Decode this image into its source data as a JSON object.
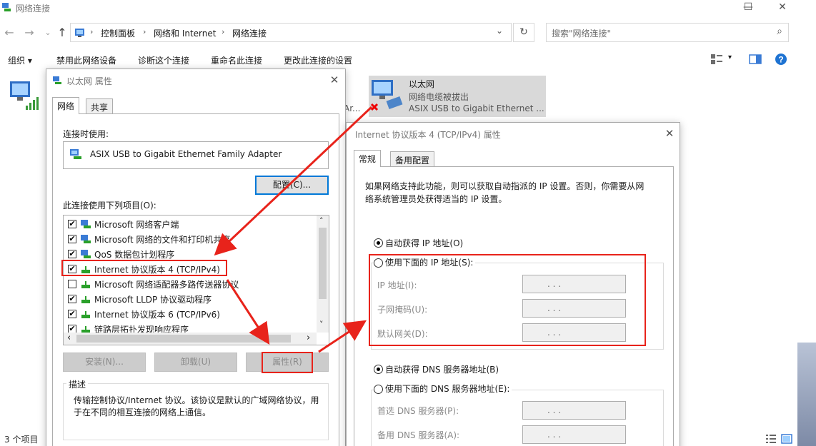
{
  "window": {
    "title": "网络连接",
    "controls": {
      "minimize": "—",
      "maximize": "☐",
      "close": "✕"
    }
  },
  "nav": {
    "back": "←",
    "forward": "→",
    "dropdown": "⌄",
    "up": "↑",
    "address_dropdown": "⌄",
    "refresh": "↻"
  },
  "address": {
    "crumbs": [
      "控制面板",
      "网络和 Internet",
      "网络连接"
    ],
    "sep": "›"
  },
  "search": {
    "placeholder": "搜索\"网络连接\"",
    "icon": "⌕"
  },
  "toolbar": {
    "items": [
      "组织 ▾",
      "禁用此网络设备",
      "诊断这个连接",
      "重命名此连接",
      "更改此连接的设置"
    ],
    "view_arrow": "▾"
  },
  "connection": {
    "name": "以太网",
    "status": "网络电缆被拔出",
    "adapter": "ASIX USB to Gigabit Ethernet ...",
    "partial_label": "Ar..."
  },
  "status_bar": {
    "count": "3 个项目"
  },
  "props_dialog": {
    "title": "以太网 属性",
    "close": "✕",
    "tabs": [
      "网络",
      "共享"
    ],
    "connect_using_label": "连接时使用:",
    "adapter_name": "ASIX USB to Gigabit Ethernet Family Adapter",
    "configure_button": "配置(C)...",
    "items_label": "此连接使用下列项目(O):",
    "items": [
      {
        "checked": true,
        "text": "Microsoft 网络客户端"
      },
      {
        "checked": true,
        "text": "Microsoft 网络的文件和打印机共享"
      },
      {
        "checked": true,
        "text": "QoS 数据包计划程序"
      },
      {
        "checked": true,
        "text": "Internet 协议版本 4 (TCP/IPv4)"
      },
      {
        "checked": false,
        "text": "Microsoft 网络适配器多路传送器协议"
      },
      {
        "checked": true,
        "text": "Microsoft LLDP 协议驱动程序"
      },
      {
        "checked": true,
        "text": "Internet 协议版本 6 (TCP/IPv6)"
      },
      {
        "checked": true,
        "text": "链路层拓扑发现响应程序"
      }
    ],
    "scroll": {
      "up": "˄",
      "down": "˅",
      "left": "‹",
      "right": "›"
    },
    "check_mark": "✔",
    "install_button": "安装(N)...",
    "uninstall_button": "卸载(U)",
    "properties_button": "属性(R)",
    "description_label": "描述",
    "description_text": "传输控制协议/Internet 协议。该协议是默认的广域网络协议，用于在不同的相互连接的网络上通信。"
  },
  "ipv4_dialog": {
    "title": "Internet 协议版本 4 (TCP/IPv4) 属性",
    "close": "✕",
    "tabs": [
      "常规",
      "备用配置"
    ],
    "intro": "如果网络支持此功能，则可以获取自动指派的 IP 设置。否则，你需要从网络系统管理员处获得适当的 IP 设置。",
    "auto_ip": "自动获得 IP 地址(O)",
    "manual_ip": "使用下面的 IP 地址(S):",
    "ip_label": "IP 地址(I):",
    "mask_label": "子网掩码(U):",
    "gateway_label": "默认网关(D):",
    "auto_dns": "自动获得 DNS 服务器地址(B)",
    "manual_dns": "使用下面的 DNS 服务器地址(E):",
    "preferred_dns": "首选 DNS 服务器(P):",
    "alternate_dns": "备用 DNS 服务器(A):",
    "ip_dots": ".       .       ."
  },
  "colors": {
    "annotation_red": "#e8231b",
    "focus_blue": "#0078d7",
    "selection_gray": "#d9d9d9"
  }
}
